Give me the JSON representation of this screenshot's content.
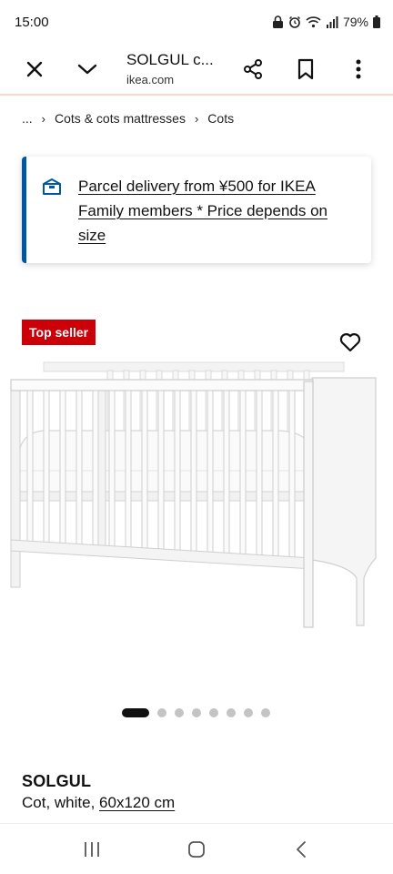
{
  "status_bar": {
    "time": "15:00",
    "battery": "79%"
  },
  "toolbar": {
    "title": "SOLGUL c...",
    "url": "ikea.com"
  },
  "breadcrumb": {
    "ellipsis": "...",
    "items": [
      "Cots & cots mattresses",
      "Cots"
    ]
  },
  "delivery_banner": {
    "text": "Parcel delivery from ¥500 for IKEA Family members * Price depends on size",
    "accent_color": "#0058a3",
    "icon": "delivery-box-icon"
  },
  "badge": {
    "label": "Top seller",
    "color": "#cc0008"
  },
  "carousel": {
    "total": 8,
    "active_index": 0
  },
  "product": {
    "name": "SOLGUL",
    "desc_prefix": "Cot, white, ",
    "size": "60x120 cm"
  }
}
